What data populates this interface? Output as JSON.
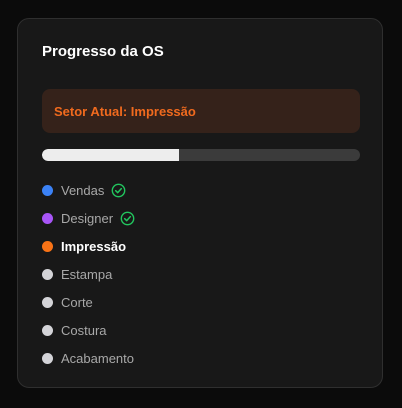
{
  "card": {
    "title": "Progresso da OS",
    "sector_label": "Setor Atual: Impressão",
    "progress": 0.43
  },
  "steps": [
    {
      "label": "Vendas",
      "color": "#3b82f6",
      "status": "done",
      "icon": "check-circle-icon"
    },
    {
      "label": "Designer",
      "color": "#a855f7",
      "status": "done",
      "icon": "check-circle-icon"
    },
    {
      "label": "Impressão",
      "color": "#f97316",
      "status": "current"
    },
    {
      "label": "Estampa",
      "color": "#d4d4d8",
      "status": "pending"
    },
    {
      "label": "Corte",
      "color": "#d4d4d8",
      "status": "pending"
    },
    {
      "label": "Costura",
      "color": "#d4d4d8",
      "status": "pending"
    },
    {
      "label": "Acabamento",
      "color": "#d4d4d8",
      "status": "pending"
    }
  ],
  "colors": {
    "done_check": "#22c55e",
    "accent": "#f06a1e"
  }
}
